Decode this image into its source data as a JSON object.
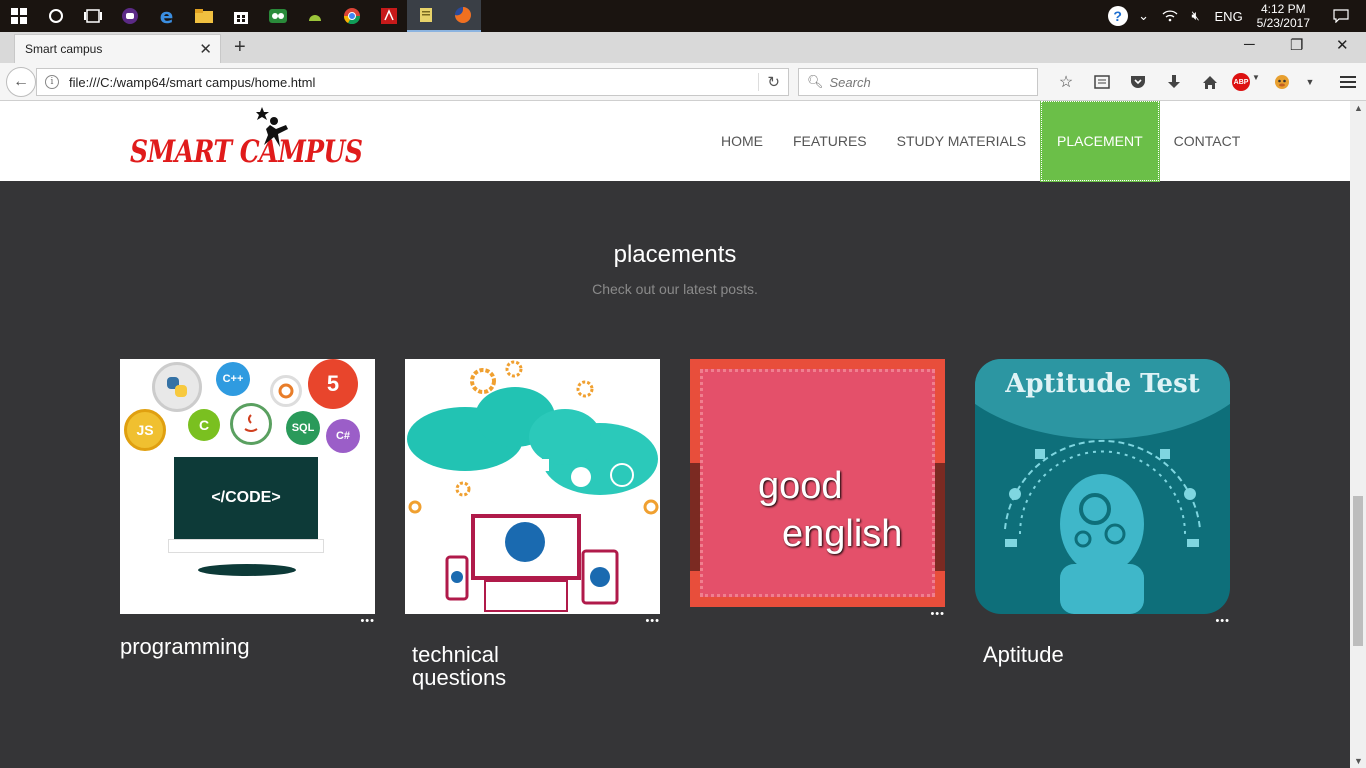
{
  "taskbar": {
    "apps": [
      "windows-start",
      "cortana",
      "task-view",
      "app-purple",
      "edge",
      "file-explorer",
      "store",
      "tripadvisor",
      "android",
      "chrome",
      "acrobat",
      "notes",
      "firefox"
    ],
    "tray_language": "ENG",
    "clock_time": "4:12 PM",
    "clock_date": "5/23/2017"
  },
  "browser": {
    "tab_title": "Smart campus",
    "url": "file:///C:/wamp64/smart campus/home.html",
    "search_placeholder": "Search"
  },
  "site": {
    "logo_text": "SMART CAMPUS",
    "menu": [
      "HOME",
      "FEATURES",
      "STUDY MATERIALS",
      "PLACEMENT",
      "CONTACT"
    ],
    "active_menu": "PLACEMENT",
    "accent_color": "#6bbf48"
  },
  "section": {
    "title": "placements",
    "subtitle": "Check out our latest posts."
  },
  "cards": [
    {
      "title": "programming",
      "dots": "•••",
      "image": {
        "badges": [
          "C++",
          "JS",
          "C",
          "SQL",
          "C#",
          "5"
        ],
        "monitor_text": "</CODE>"
      }
    },
    {
      "title": "technical questions",
      "dots": "•••"
    },
    {
      "title": "",
      "dots": "•••",
      "image": {
        "word1": "good",
        "word2": "english"
      }
    },
    {
      "title": "Aptitude",
      "dots": "•••",
      "image": {
        "heading": "Aptitude Test"
      }
    }
  ]
}
